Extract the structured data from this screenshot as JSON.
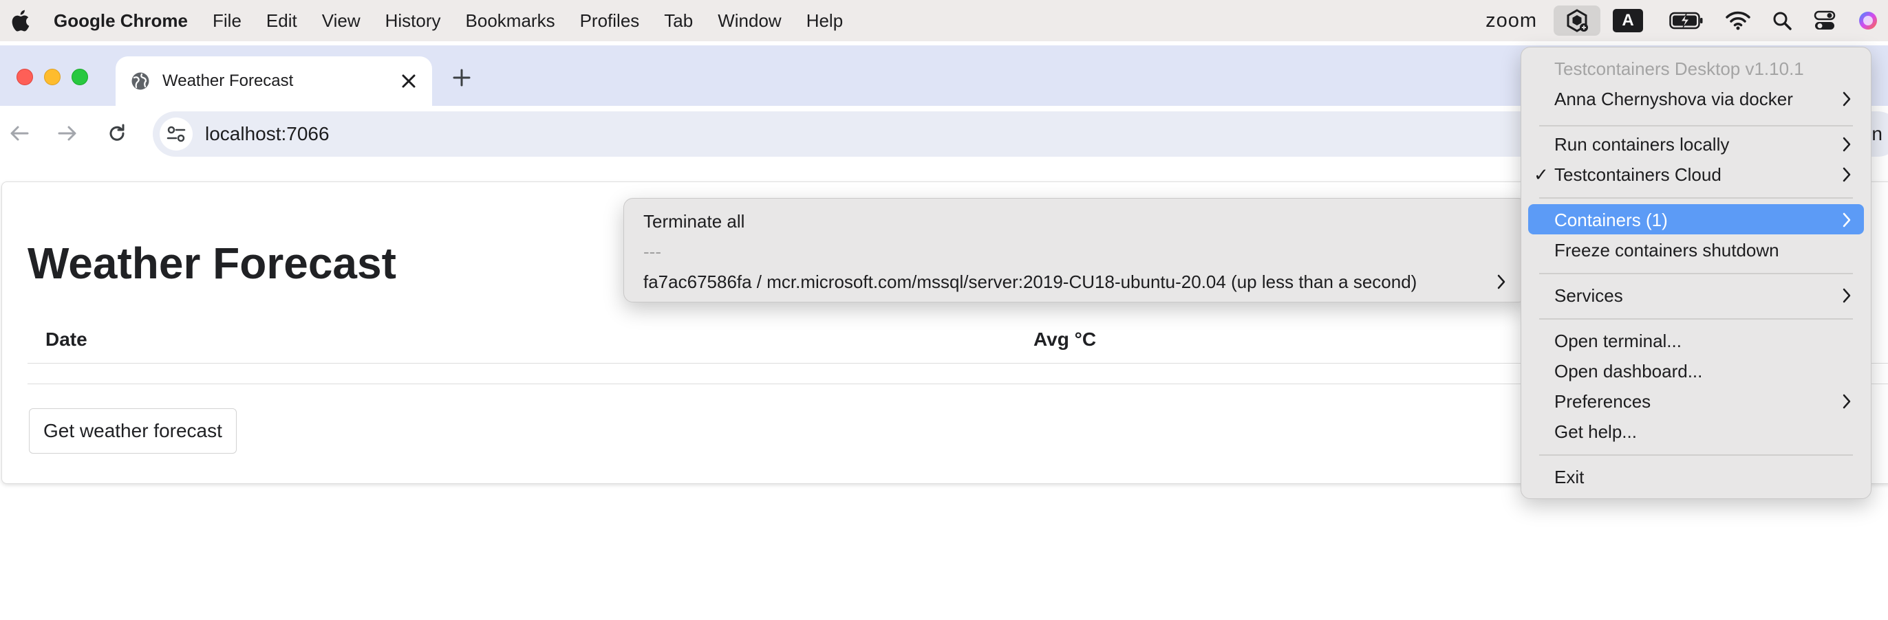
{
  "menubar": {
    "app_name": "Google Chrome",
    "items": [
      "File",
      "Edit",
      "View",
      "History",
      "Bookmarks",
      "Profiles",
      "Tab",
      "Window",
      "Help"
    ],
    "zoom_label": "zoom",
    "input_badge": "A"
  },
  "browser": {
    "tab_title": "Weather Forecast",
    "url": "localhost:7066",
    "url_tail": "un"
  },
  "page": {
    "title": "Weather Forecast",
    "columns": [
      "Date",
      "Avg °C"
    ],
    "button_label": "Get weather forecast"
  },
  "containers_submenu": {
    "terminate_all": "Terminate all",
    "separator_text": "---",
    "container_entry": "fa7ac67586fa / mcr.microsoft.com/mssql/server:2019-CU18-ubuntu-20.04 (up less than a second)"
  },
  "tray_menu": {
    "version": "Testcontainers Desktop v1.10.1",
    "account": "Anna Chernyshova via docker",
    "run_locally": "Run containers locally",
    "cloud": "Testcontainers Cloud",
    "containers": "Containers (1)",
    "freeze": "Freeze containers shutdown",
    "services": "Services",
    "open_terminal": "Open terminal...",
    "open_dashboard": "Open dashboard...",
    "preferences": "Preferences",
    "get_help": "Get help...",
    "exit": "Exit",
    "checkmark": "✓"
  },
  "colors": {
    "highlight": "#5c9bf6",
    "tabstrip": "#dfe4f6",
    "menubar": "#eeebea"
  }
}
